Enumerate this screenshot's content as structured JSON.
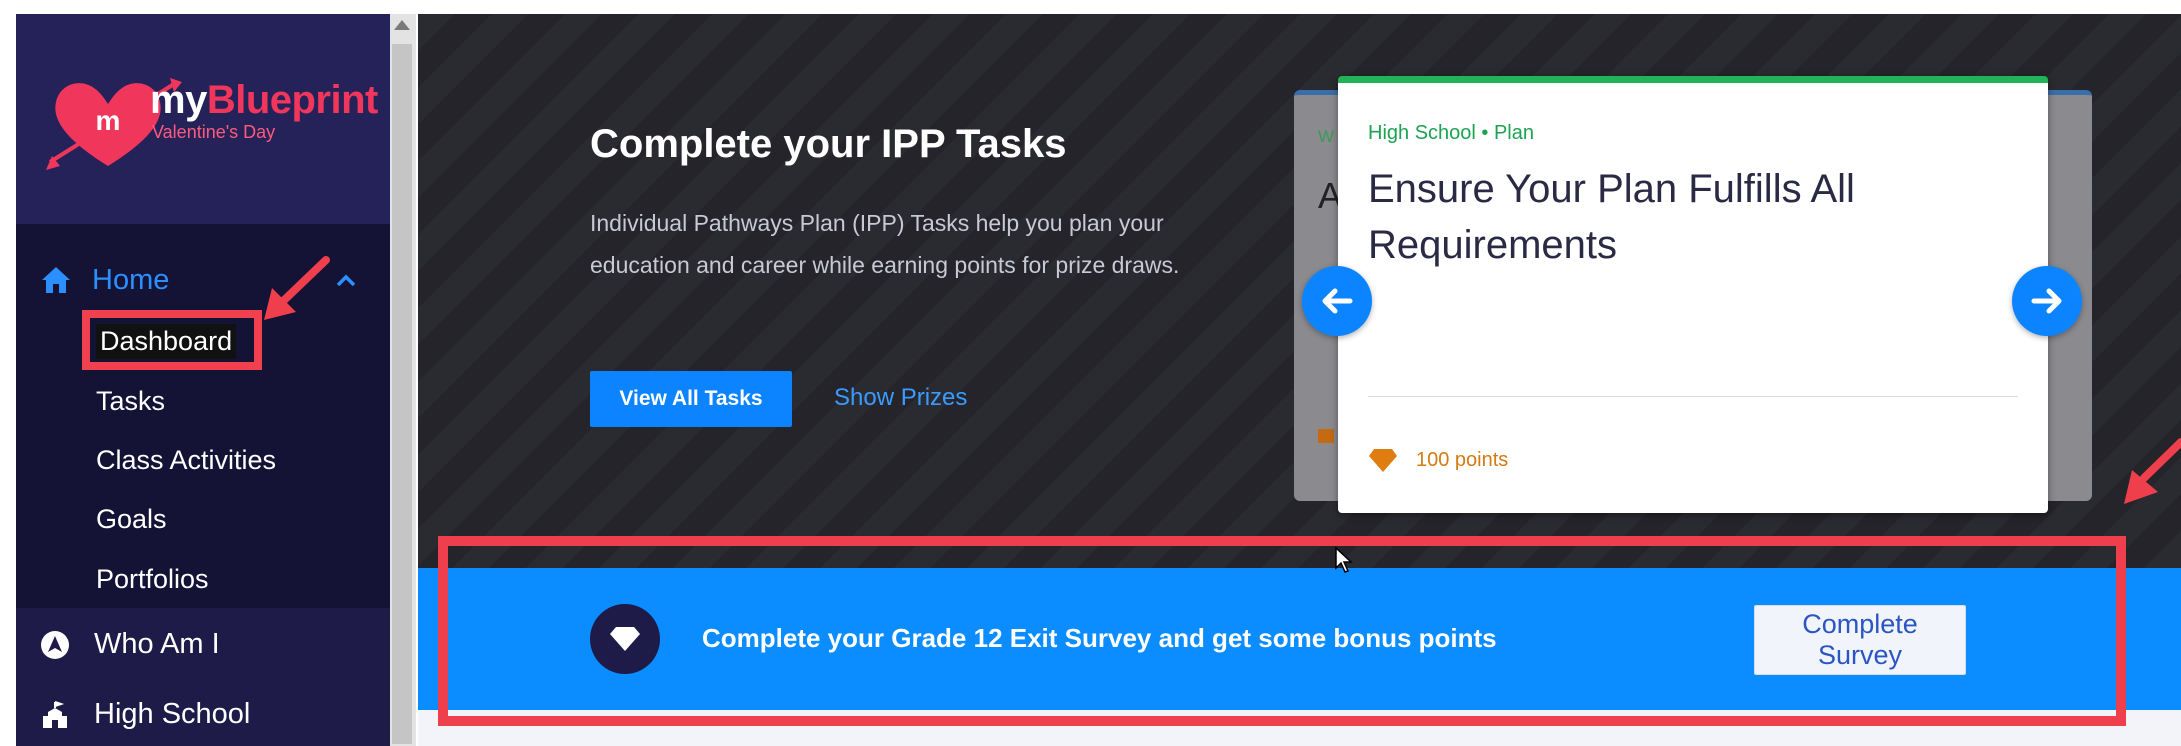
{
  "logo": {
    "brand_prefix": "my",
    "brand_name": "Blueprint",
    "subtitle": "Valentine's Day",
    "heart_letter": "m"
  },
  "sidebar": {
    "home": {
      "label": "Home",
      "icon": "home-icon"
    },
    "home_children": [
      {
        "label": "Dashboard",
        "active": true
      },
      {
        "label": "Tasks"
      },
      {
        "label": "Class Activities"
      },
      {
        "label": "Goals"
      },
      {
        "label": "Portfolios"
      }
    ],
    "sections": [
      {
        "label": "Who Am I",
        "icon": "compass-icon"
      },
      {
        "label": "High School",
        "icon": "school-icon"
      }
    ]
  },
  "hero": {
    "title": "Complete your IPP Tasks",
    "description": "Individual Pathways Plan (IPP) Tasks help you plan your education and career while earning points for prize draws.",
    "primary_button": "View All Tasks",
    "secondary_link": "Show Prizes"
  },
  "task_card": {
    "tag": "High School • Plan",
    "title": "Ensure Your Plan Fulfills All Requirements",
    "points": "100 points",
    "back_card_tag": "W",
    "back_card_title": "A"
  },
  "banner": {
    "text": "Complete your Grade 12 Exit Survey and get some bonus points",
    "button": "Complete Survey"
  },
  "colors": {
    "accent": "#0d84ff",
    "sidebar_bg": "#1e1b48",
    "annotation_red": "#ef3f4c",
    "points_orange": "#d67a12",
    "tag_green": "#1ca352"
  }
}
